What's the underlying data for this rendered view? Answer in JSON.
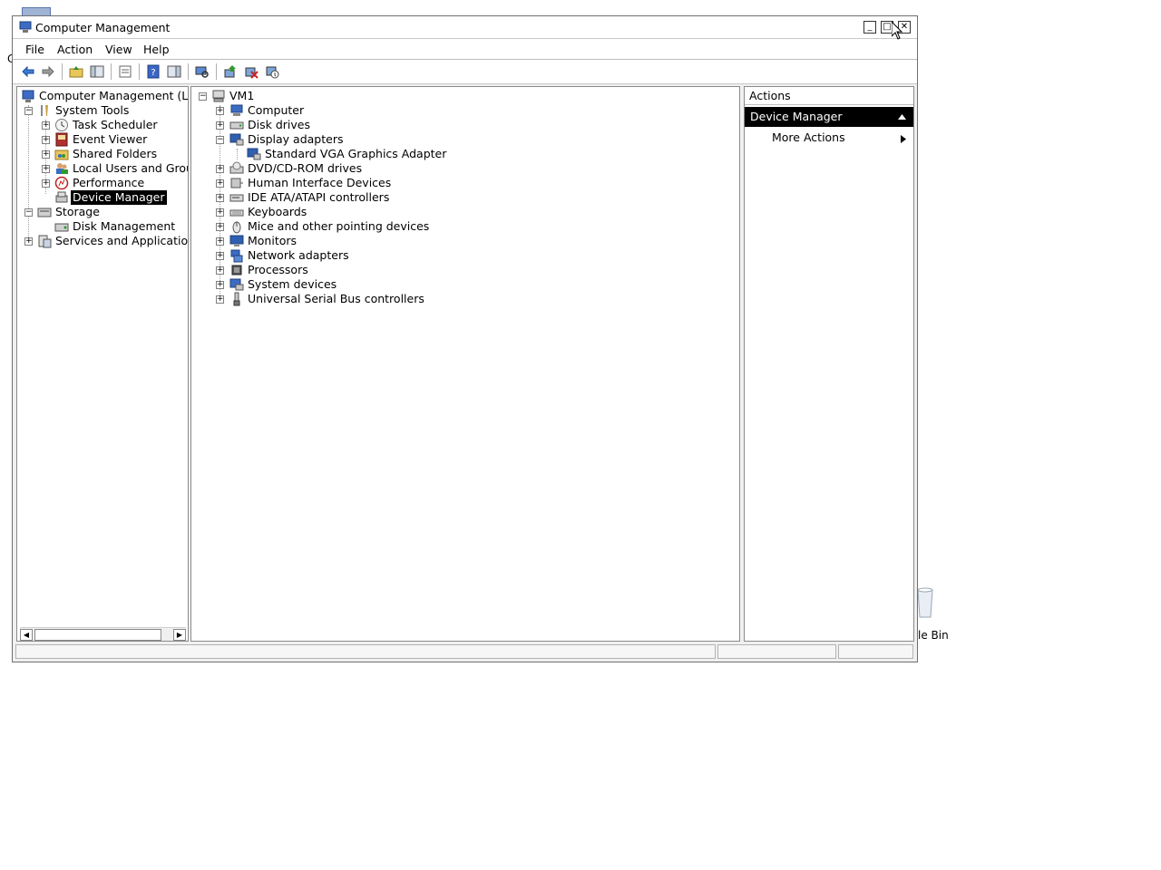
{
  "desktop": {
    "fragment_left": "C",
    "recycle_label": "le Bin"
  },
  "window": {
    "title": "Computer Management",
    "controls": {
      "minimize": "_",
      "maximize": "□",
      "close": "✕"
    }
  },
  "menu": [
    "File",
    "Action",
    "View",
    "Help"
  ],
  "toolbar_icons": [
    "back-icon",
    "forward-icon",
    "up-folder-icon",
    "show-hide-console-tree-icon",
    "properties-icon",
    "help-icon",
    "show-hide-action-pane-icon",
    "scan-hardware-icon",
    "update-driver-icon",
    "uninstall-icon",
    "disable-device-icon"
  ],
  "left_tree": [
    {
      "label": "Computer Management (Local",
      "icon": "computer-management-icon",
      "expander": ""
    },
    {
      "label": "System Tools",
      "icon": "system-tools-icon",
      "expander": "−"
    },
    {
      "label": "Task Scheduler",
      "icon": "clock-icon",
      "expander": "+"
    },
    {
      "label": "Event Viewer",
      "icon": "event-viewer-icon",
      "expander": "+"
    },
    {
      "label": "Shared Folders",
      "icon": "shared-folders-icon",
      "expander": "+"
    },
    {
      "label": "Local Users and Group",
      "icon": "users-icon",
      "expander": "+"
    },
    {
      "label": "Performance",
      "icon": "performance-icon",
      "expander": "+"
    },
    {
      "label": "Device Manager",
      "icon": "device-manager-icon",
      "expander": "",
      "selected": true
    },
    {
      "label": "Storage",
      "icon": "storage-icon",
      "expander": "−"
    },
    {
      "label": "Disk Management",
      "icon": "disk-management-icon",
      "expander": ""
    },
    {
      "label": "Services and Applications",
      "icon": "services-icon",
      "expander": "+"
    }
  ],
  "device_tree": {
    "root": "VM1",
    "items": [
      {
        "label": "Computer",
        "expander": "+",
        "icon": "computer-icon"
      },
      {
        "label": "Disk drives",
        "expander": "+",
        "icon": "disk-drive-icon"
      },
      {
        "label": "Display adapters",
        "expander": "−",
        "icon": "display-adapter-icon"
      },
      {
        "label": "Standard VGA Graphics Adapter",
        "expander": "",
        "icon": "display-adapter-icon",
        "child": true
      },
      {
        "label": "DVD/CD-ROM drives",
        "expander": "+",
        "icon": "dvd-icon"
      },
      {
        "label": "Human Interface Devices",
        "expander": "+",
        "icon": "hid-icon"
      },
      {
        "label": "IDE ATA/ATAPI controllers",
        "expander": "+",
        "icon": "ide-controller-icon"
      },
      {
        "label": "Keyboards",
        "expander": "+",
        "icon": "keyboard-icon"
      },
      {
        "label": "Mice and other pointing devices",
        "expander": "+",
        "icon": "mouse-icon"
      },
      {
        "label": "Monitors",
        "expander": "+",
        "icon": "monitor-icon"
      },
      {
        "label": "Network adapters",
        "expander": "+",
        "icon": "network-adapter-icon"
      },
      {
        "label": "Processors",
        "expander": "+",
        "icon": "processor-icon"
      },
      {
        "label": "System devices",
        "expander": "+",
        "icon": "system-devices-icon"
      },
      {
        "label": "Universal Serial Bus controllers",
        "expander": "+",
        "icon": "usb-icon"
      }
    ]
  },
  "actions": {
    "header": "Actions",
    "section": "Device Manager",
    "more": "More Actions"
  },
  "scroll": {
    "left": "◀",
    "right": "▶"
  },
  "colors": {
    "selection": "#000000",
    "window_bg": "#f0f0f0",
    "accent_blue": "#2f5fb0"
  }
}
